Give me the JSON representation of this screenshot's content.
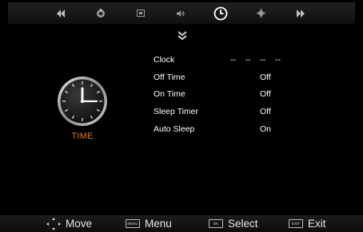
{
  "tabs": [
    {
      "icon": "rewind-icon"
    },
    {
      "icon": "picture-icon"
    },
    {
      "icon": "tv-channel-icon"
    },
    {
      "icon": "speaker-icon"
    },
    {
      "icon": "clock-icon",
      "selected": true
    },
    {
      "icon": "gear-icon"
    },
    {
      "icon": "fast-forward-icon"
    }
  ],
  "section": {
    "label": "TIME",
    "label_color": "#e07722"
  },
  "settings": [
    {
      "label": "Clock",
      "value": "--    --    --    --"
    },
    {
      "label": "Off Time",
      "value": "Off"
    },
    {
      "label": "On Time",
      "value": "Off"
    },
    {
      "label": "Sleep Timer",
      "value": "Off"
    },
    {
      "label": "Auto Sleep",
      "value": "On"
    }
  ],
  "hints": [
    {
      "key": "",
      "label": "Move",
      "icon": "arrow-keys-icon"
    },
    {
      "key": "MENU",
      "label": "Menu"
    },
    {
      "key": "OK",
      "label": "Select"
    },
    {
      "key": "EXIT",
      "label": "Exit"
    }
  ],
  "colors": {
    "background": "#000000",
    "accent": "#e07722",
    "text": "#ffffff"
  }
}
